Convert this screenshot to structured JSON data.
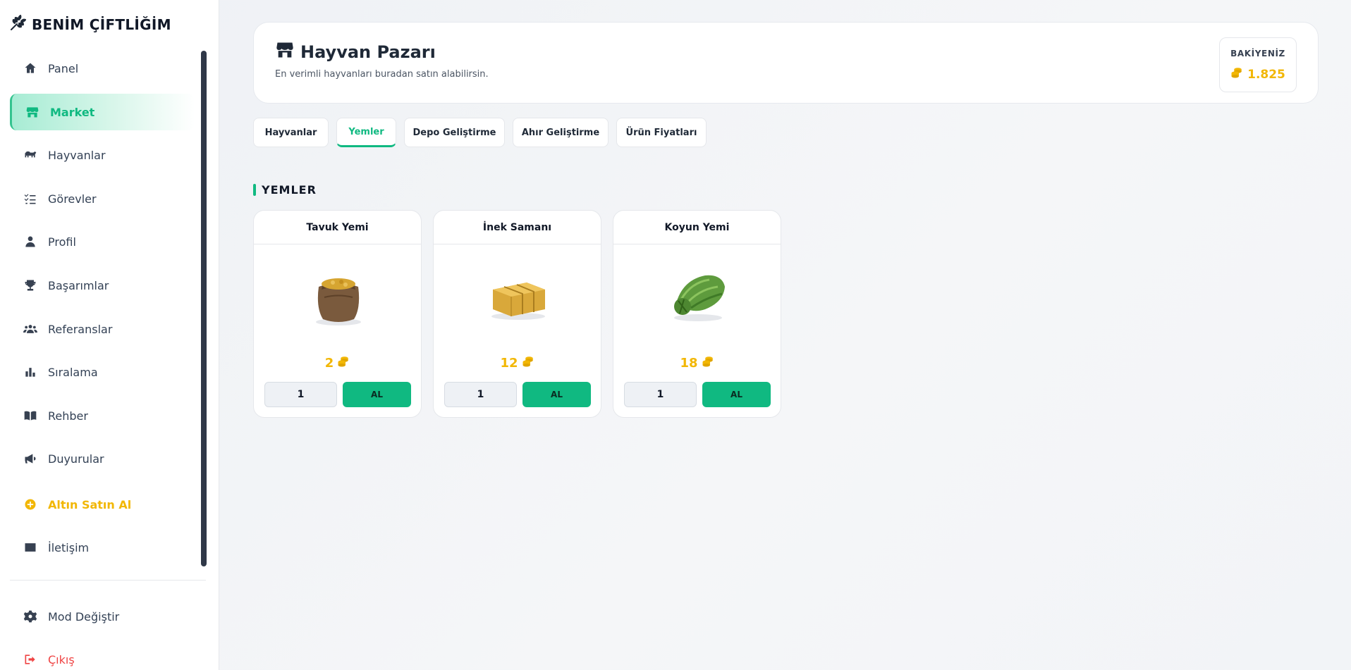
{
  "brand": {
    "name": "BENİM ÇİFTLİĞİM"
  },
  "sidebar": {
    "items": [
      {
        "label": "Panel",
        "icon": "home-icon"
      },
      {
        "label": "Market",
        "icon": "store-icon"
      },
      {
        "label": "Hayvanlar",
        "icon": "animal-icon"
      },
      {
        "label": "Görevler",
        "icon": "tasks-icon"
      },
      {
        "label": "Profil",
        "icon": "user-icon"
      },
      {
        "label": "Başarımlar",
        "icon": "trophy-icon"
      },
      {
        "label": "Referanslar",
        "icon": "users-icon"
      },
      {
        "label": "Sıralama",
        "icon": "chart-icon"
      },
      {
        "label": "Rehber",
        "icon": "book-icon"
      },
      {
        "label": "Duyurular",
        "icon": "megaphone-icon"
      },
      {
        "label": "Altın Satın Al",
        "icon": "plus-circle-icon"
      },
      {
        "label": "İletişim",
        "icon": "envelope-icon"
      }
    ],
    "bottom": [
      {
        "label": "Mod Değiştir",
        "icon": "gear-icon"
      },
      {
        "label": "Çıkış",
        "icon": "logout-icon"
      }
    ]
  },
  "header": {
    "title": "Hayvan Pazarı",
    "subtitle": "En verimli hayvanları buradan satın alabilirsin.",
    "balance_label": "BAKİYENİZ",
    "balance_value": "1.825"
  },
  "tabs": [
    "Hayvanlar",
    "Yemler",
    "Depo Geliştirme",
    "Ahır Geliştirme",
    "Ürün Fiyatları"
  ],
  "active_tab": "Yemler",
  "section": {
    "title": "YEMLER"
  },
  "products": [
    {
      "name": "Tavuk Yemi",
      "price": "2",
      "qty": "1",
      "buy_label": "AL"
    },
    {
      "name": "İnek Samanı",
      "price": "12",
      "qty": "1",
      "buy_label": "AL"
    },
    {
      "name": "Koyun Yemi",
      "price": "18",
      "qty": "1",
      "buy_label": "AL"
    }
  ],
  "colors": {
    "accent": "#10b981",
    "gold": "#f2b705",
    "danger": "#ef4444"
  }
}
